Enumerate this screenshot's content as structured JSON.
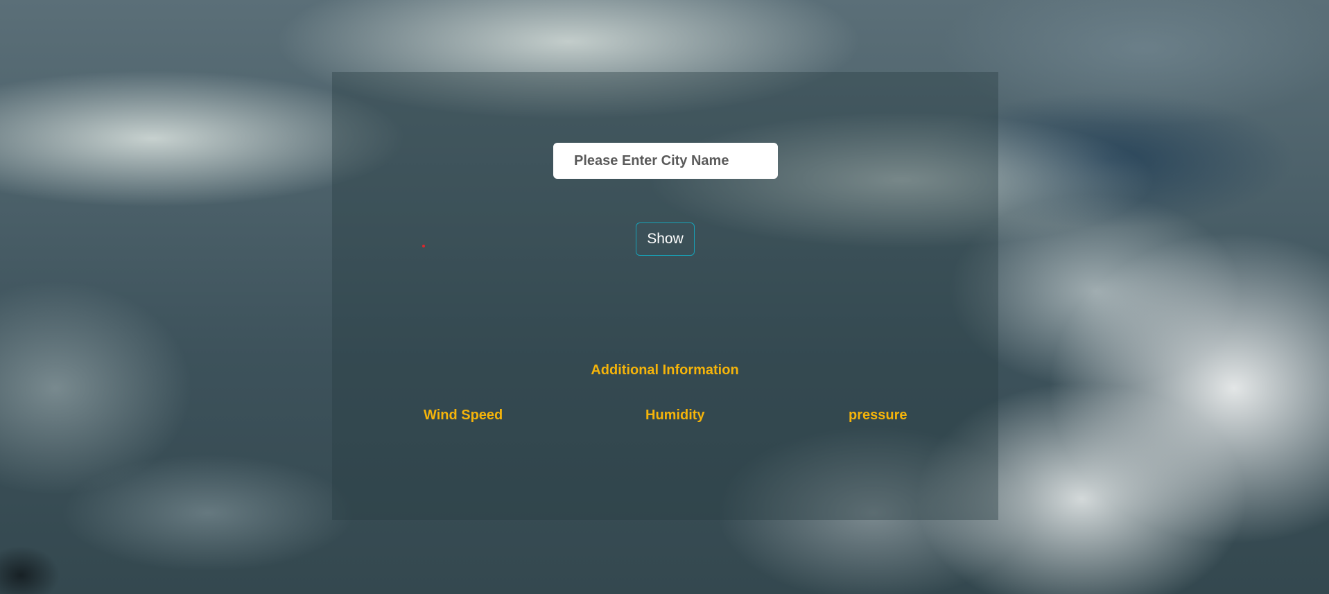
{
  "search": {
    "placeholder": "Please Enter City Name",
    "value": ""
  },
  "actions": {
    "show_label": "Show"
  },
  "additional_info": {
    "title": "Additional Information",
    "labels": {
      "wind_speed": "Wind Speed",
      "humidity": "Humidity",
      "pressure": "pressure"
    }
  },
  "colors": {
    "accent": "#f5b40a",
    "button_border": "#17a2b8",
    "marker": "#e0262b"
  }
}
